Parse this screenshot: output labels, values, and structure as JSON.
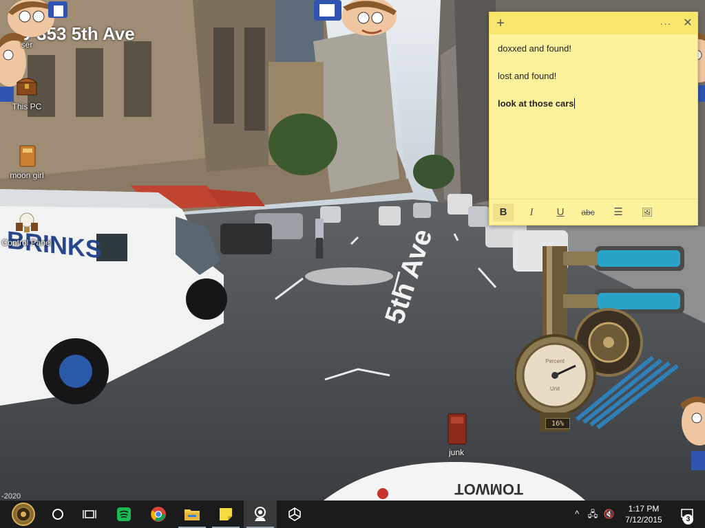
{
  "wallpaper": {
    "street_title": "9-353 5th Ave",
    "road_marking": "5th Ave",
    "truck_text": "BRINKS",
    "car_plate_text": "TOMWOT",
    "corner_text": "-2020"
  },
  "desktop_icons": [
    {
      "label": "ser",
      "icon": "browser-icon"
    },
    {
      "label": "This PC",
      "icon": "chest-icon"
    },
    {
      "label": "moon girl",
      "icon": "folder-icon"
    },
    {
      "label": "Control Panel",
      "icon": "lightbulb-icon"
    }
  ],
  "junk_icon": {
    "label": "junk",
    "icon": "folder-icon"
  },
  "sticky_note": {
    "lines": [
      "doxxed and found!",
      "lost and found!",
      "look at those cars"
    ],
    "add_label": "+",
    "menu_label": "···",
    "close_label": "✕",
    "toolbar": {
      "bold": "B",
      "italic": "I",
      "underline": "U",
      "strike": "abc",
      "list": "☰",
      "image": "🖼"
    },
    "colors": {
      "body": "#fef29c",
      "header": "#fbe66d"
    }
  },
  "gauge": {
    "readout": "16%",
    "level": 0.16,
    "dial_label_top": "Percent",
    "dial_label_bottom": "Unit"
  },
  "taskbar": {
    "apps": [
      {
        "name": "start-button",
        "icon": "steampunk-start-icon"
      },
      {
        "name": "cortana",
        "icon": "circle-icon"
      },
      {
        "name": "task-view",
        "icon": "task-view-icon"
      },
      {
        "name": "spotify",
        "icon": "spotify-icon"
      },
      {
        "name": "chrome",
        "icon": "chrome-icon"
      },
      {
        "name": "file-explorer",
        "icon": "folder-icon"
      },
      {
        "name": "sticky-notes",
        "icon": "sticky-notes-icon"
      },
      {
        "name": "app-pin",
        "icon": "pin-icon"
      },
      {
        "name": "unity",
        "icon": "unity-icon"
      }
    ],
    "tray": {
      "chevron": "^",
      "network": "🖧",
      "volume": "🔇"
    },
    "clock": {
      "time": "1:17 PM",
      "date": "7/12/2015"
    },
    "notification_count": "3"
  }
}
